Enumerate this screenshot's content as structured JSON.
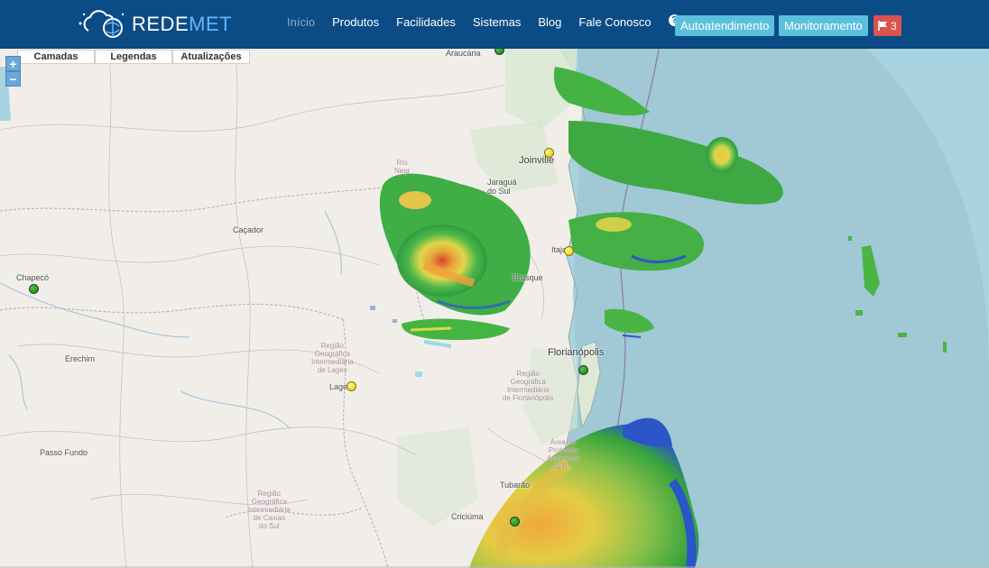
{
  "header": {
    "logo_text_main": "REDE",
    "logo_text_accent": "MET",
    "nav": [
      {
        "label": "Início",
        "active": true
      },
      {
        "label": "Produtos",
        "active": false
      },
      {
        "label": "Facilidades",
        "active": false
      },
      {
        "label": "Sistemas",
        "active": false
      },
      {
        "label": "Blog",
        "active": false
      },
      {
        "label": "Fale Conosco",
        "active": false
      }
    ],
    "help_icon": "question-circle-icon",
    "btn_autoatendimento": "Autoatendimento",
    "btn_monitoramento": "Monitoramento",
    "flag_count": "3",
    "colors": {
      "navbar": "#0b4c86",
      "button": "#5bc0de",
      "alert": "#d9534f"
    }
  },
  "map": {
    "tabs": [
      "Camadas",
      "Legendas",
      "Atualizações"
    ],
    "zoom_in": "+",
    "zoom_out": "−",
    "cities": [
      "Araucária",
      "Joinville",
      "Jaraguá do Sul",
      "Caçador",
      "Chapecó",
      "Itajaí",
      "Brusque",
      "Erechim",
      "Lages",
      "Florianópolis",
      "Passo Fundo",
      "Tubarão",
      "Criciúma"
    ],
    "regions": [
      "Região\nGeográfica\nIntermediária\nde Lages",
      "Região\nGeográfica\nIntermediária\nde Florianópolis",
      "Região\nGeográfica\nIntermediária\nde Caxias\ndo Sul",
      "Área de\nProteção\nAmbiental\nda B..."
    ],
    "partial_label": "Rio\nNegr",
    "stations_count_green": 4,
    "stations_count_yellow": 3
  }
}
